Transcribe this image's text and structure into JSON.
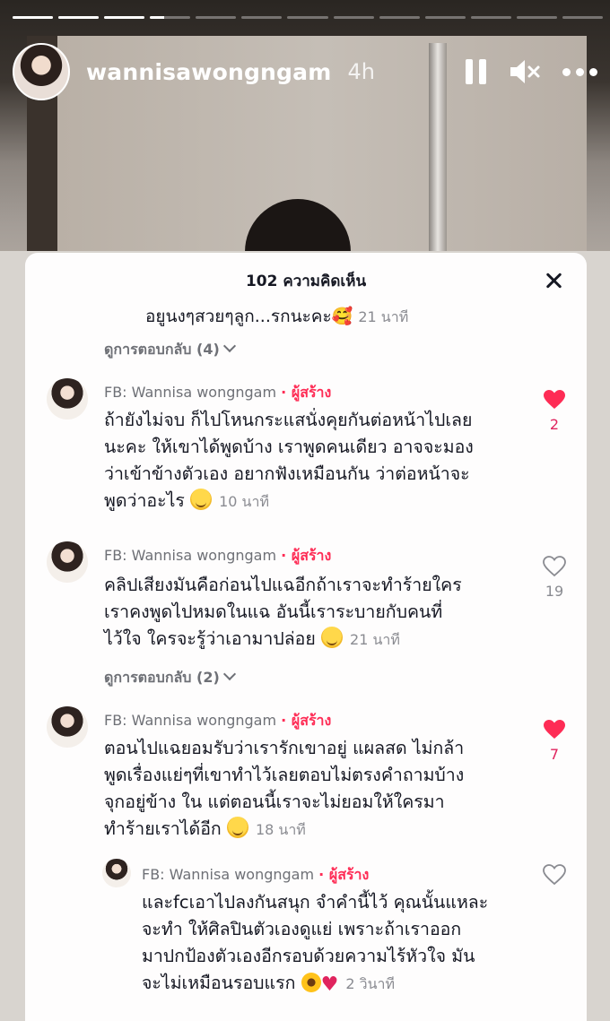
{
  "story": {
    "progress": [
      1,
      1,
      1,
      0.35,
      0,
      0,
      0,
      0,
      0,
      0,
      0,
      0,
      0
    ],
    "username": "wannisawongngam",
    "time_ago": "4h"
  },
  "sheet": {
    "title": "102 ความคิดเห็น",
    "partial_comment": {
      "text": "อยูนงๆสวยๆลูก...รกนะคะ🥰",
      "time": "21 นาที"
    },
    "view_replies_1": "ดูการตอบกลับ (4)",
    "view_replies_2": "ดูการตอบกลับ (2)",
    "comments": [
      {
        "author": "FB: Wannisa wongngam",
        "role": "· ผู้สร้าง",
        "lines": [
          "ถ้ายังไม่จบ ก็ไปโหนกระแสนั่งคุยกันต่อหน้าไปเลย",
          "นะคะ ให้เขาได้พูดบ้าง เราพูดคนเดียว อาจจะมอง",
          "ว่าเข้าข้างตัวเอง อยากฟังเหมือนกัน ว่าต่อหน้าจะ",
          "พูดว่าอะไร"
        ],
        "time": "10 นาที",
        "likes": "2",
        "liked": true
      },
      {
        "author": "FB: Wannisa wongngam",
        "role": "· ผู้สร้าง",
        "lines": [
          "คลิปเสียงมันคือก่อนไปแฉอีกถ้าเราจะทำร้ายใคร",
          "เราคงพูดไปหมดในแฉ อันนี้เราระบายกับคนที่",
          "ไว้ใจ ใครจะรู้ว่าเอามาปล่อย"
        ],
        "time": "21 นาที",
        "likes": "19",
        "liked": false
      },
      {
        "author": "FB: Wannisa wongngam",
        "role": "· ผู้สร้าง",
        "lines": [
          "ตอนไปแฉยอมรับว่าเรารักเขาอยู่ แผลสด ไม่กล้า",
          "พูดเรื่องแย่ๆที่เขาทำไว้เลยตอบไม่ตรงคำถามบ้าง",
          "จุกอยู่ข้าง ใน แต่ตอนนี้เราจะไม่ยอมให้ใครมา",
          "ทำร้ายเราได้อีก"
        ],
        "time": "18 นาที",
        "likes": "7",
        "liked": true
      },
      {
        "author": "FB: Wannisa wongngam",
        "role": "· ผู้สร้าง",
        "lines": [
          "และfcเอาไปลงกันสนุก จำคำนี้ไว้ คุณนั้นแหละ",
          "จะทำ ให้ศิลปินตัวเองดูแย่ เพราะถ้าเราออก",
          "มาปกป้องตัวเองอีกรอบด้วยความไร้หัวใจ มัน",
          "จะไม่เหมือนรอบแรก"
        ],
        "time": "2 วินาที",
        "likes": "",
        "liked": false
      }
    ]
  }
}
